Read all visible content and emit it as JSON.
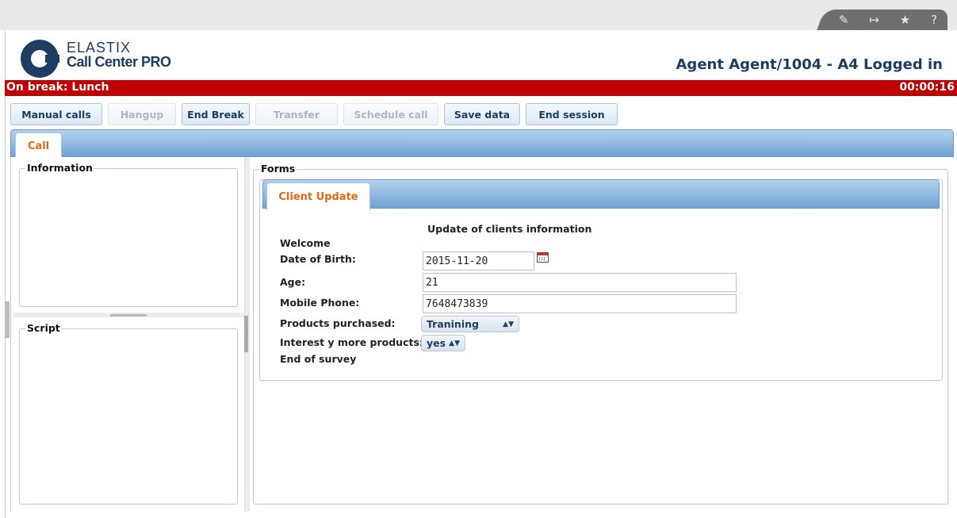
{
  "toolbar_icons": [
    "edit-icon",
    "logout-icon",
    "star-icon",
    "help-icon"
  ],
  "brand": {
    "line1": "ELASTIX",
    "line2": "Call Center PRO"
  },
  "agent_status": "Agent Agent/1004 - A4 Logged in",
  "break_bar": {
    "status": "On break: Lunch",
    "timer": "00:00:16",
    "color": "#c00000"
  },
  "buttons": {
    "manual_calls": "Manual calls",
    "hangup": "Hangup",
    "end_break": "End Break",
    "transfer": "Transfer",
    "schedule_call": "Schedule call",
    "save_data": "Save data",
    "end_session": "End session"
  },
  "main_tab": "Call",
  "panels": {
    "information": "Information",
    "script": "Script",
    "forms": "Forms"
  },
  "form": {
    "tab": "Client Update",
    "title": "Update of clients information",
    "welcome": "Welcome",
    "dob_label": "Date of Birth:",
    "dob_value": "2015-11-20",
    "age_label": "Age:",
    "age_value": "21",
    "mobile_label": "Mobile Phone:",
    "mobile_value": "7648473839",
    "products_label": "Products purchased:",
    "products_value": "Tranining",
    "interest_label": "Interest y more products:",
    "interest_value": "yes",
    "end": "End of survey"
  },
  "colors": {
    "accent_blue": "#1d3d63",
    "tab_orange": "#e06a12",
    "tab_bar": "#6fa3d4"
  }
}
